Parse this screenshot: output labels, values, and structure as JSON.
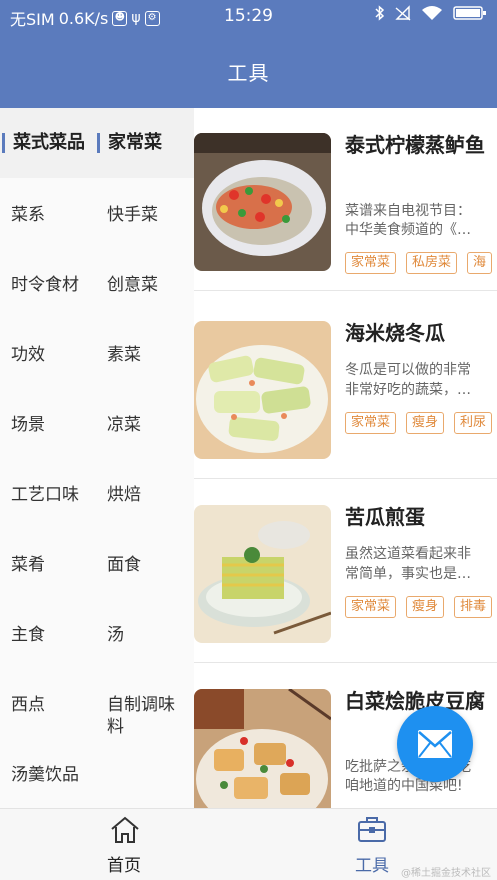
{
  "status_bar": {
    "carrier": "无SIM",
    "speed": "0.6K/s",
    "time": "15:29"
  },
  "nav": {
    "title": "工具"
  },
  "sidebar": {
    "header": [
      "菜式菜品",
      "家常菜"
    ],
    "categories": [
      "菜系",
      "快手菜",
      "时令食材",
      "创意菜",
      "功效",
      "素菜",
      "场景",
      "凉菜",
      "工艺口味",
      "烘焙",
      "菜肴",
      "面食",
      "主食",
      "汤",
      "西点",
      "自制调味料",
      "汤羹饮品"
    ]
  },
  "recipes": [
    {
      "title": "泰式柠檬蒸鲈鱼",
      "desc_line1": "菜谱来自电视节目：",
      "desc_line2": "中华美食频道的《…",
      "tags": [
        "家常菜",
        "私房菜",
        "海"
      ]
    },
    {
      "title": "海米烧冬瓜",
      "desc_line1": "冬瓜是可以做的非常",
      "desc_line2": "非常好吃的蔬菜，…",
      "tags": [
        "家常菜",
        "瘦身",
        "利尿"
      ]
    },
    {
      "title": "苦瓜煎蛋",
      "desc_line1": "虽然这道菜看起来非",
      "desc_line2": "常简单，事实也是…",
      "tags": [
        "家常菜",
        "瘦身",
        "排毒"
      ]
    },
    {
      "title": "白菜烩脆皮豆腐",
      "desc_line1": "吃批萨之余，不忘吃",
      "desc_line2": "咱地道的中国菜吧!",
      "tags": [
        "",
        "",
        ""
      ]
    }
  ],
  "tab_bar": {
    "home_label": "首页",
    "tools_label": "工具"
  },
  "icons": {
    "home": "home-icon",
    "tools": "toolbox-icon",
    "fab": "mail-icon"
  },
  "colors": {
    "primary": "#5b7bbd",
    "fab": "#1e90f0",
    "tag": "#e08a3c"
  },
  "watermark": "@稀土掘金技术社区"
}
